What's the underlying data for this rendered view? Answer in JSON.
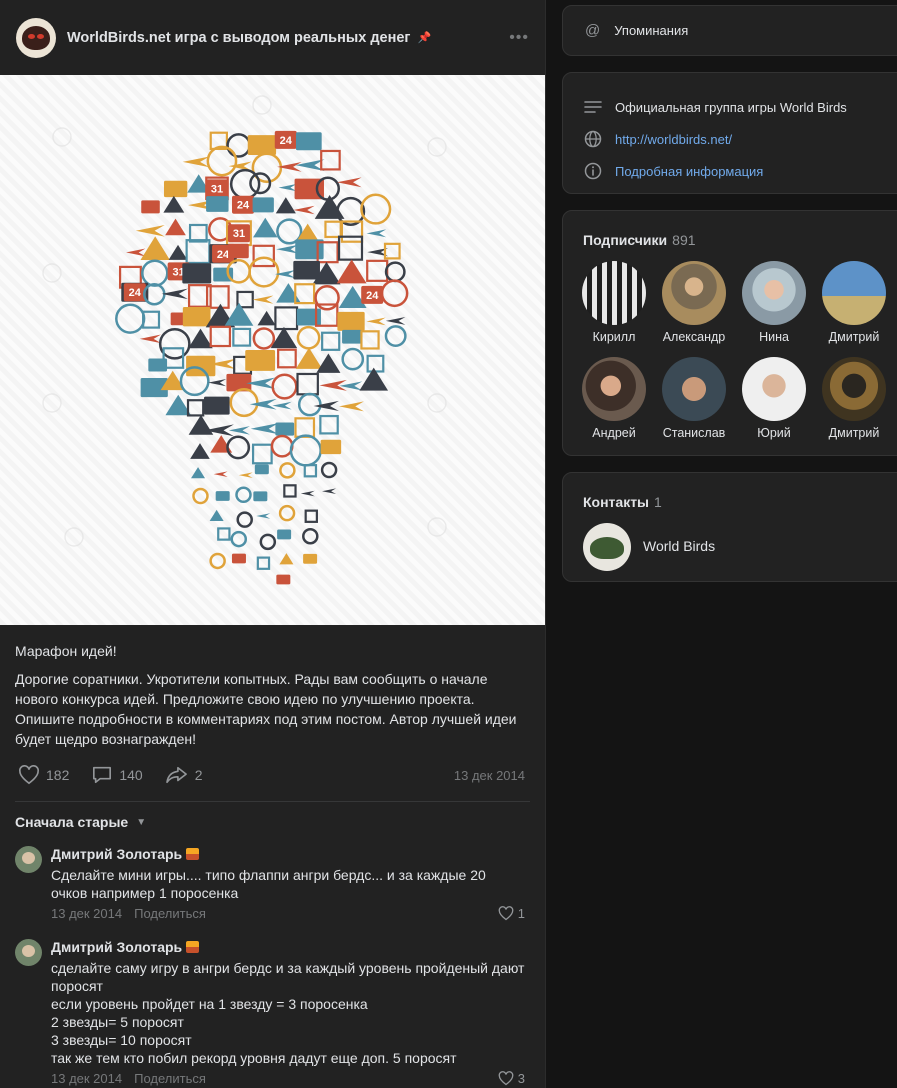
{
  "post": {
    "title": "WorldBirds.net игра с выводом реальных денег",
    "heading": "Марафон идей!",
    "body": "Дорогие соратники. Укротители копытных. Рады вам сообщить о начале нового конкурса идей. Предложите свою идею по улучшению проекта. Опишите подробности в комментариях под этим постом. Автор лучшей идеи будет щедро вознагражден!",
    "likes": "182",
    "comments": "140",
    "shares": "2",
    "date": "13 дек 2014",
    "image_icons": [
      "24",
      "31",
      "24",
      "31",
      "24",
      "31",
      "24",
      "24"
    ]
  },
  "sort_label": "Сначала старые",
  "comments": [
    {
      "author": "Дмитрий Золотарь",
      "text": "Сделайте мини игры.... типо флаппи ангри бердс... и за каждые 20 очков например 1 поросенка",
      "date": "13 дек 2014",
      "share": "Поделиться",
      "likes": "1"
    },
    {
      "author": "Дмитрий Золотарь",
      "lines": [
        "сделайте саму игру в ангри бердс и за каждый уровень пройденый дают поросят",
        "если уровень пройдет на 1 звезду = 3 поросенка",
        "2 звезды= 5 поросят",
        "3 звезды= 10 поросят",
        "так же тем кто побил рекорд уровня дадут еще доп. 5 поросят"
      ],
      "date": "13 дек 2014",
      "share": "Поделиться",
      "likes": "3"
    }
  ],
  "sidebar": {
    "mentions": "Упоминания",
    "info": {
      "description": "Официальная группа игры World Birds",
      "link": "http://worldbirds.net/",
      "more": "Подробная информация"
    },
    "subscribers": {
      "title": "Подписчики",
      "count": "891",
      "people": [
        {
          "name": "Кирилл"
        },
        {
          "name": "Александр"
        },
        {
          "name": "Нина"
        },
        {
          "name": "Дмитрий"
        },
        {
          "name": "Андрей"
        },
        {
          "name": "Станислав"
        },
        {
          "name": "Юрий"
        },
        {
          "name": "Дмитрий"
        }
      ]
    },
    "contacts": {
      "title": "Контакты",
      "count": "1",
      "name": "World Birds"
    }
  },
  "colors": {
    "background": "#141414",
    "card": "#222222",
    "link": "#71aaeb",
    "icon_blue": "#4f90a6",
    "icon_red": "#c9533b",
    "icon_orange": "#e0a33a",
    "icon_dark": "#3a3f48"
  }
}
